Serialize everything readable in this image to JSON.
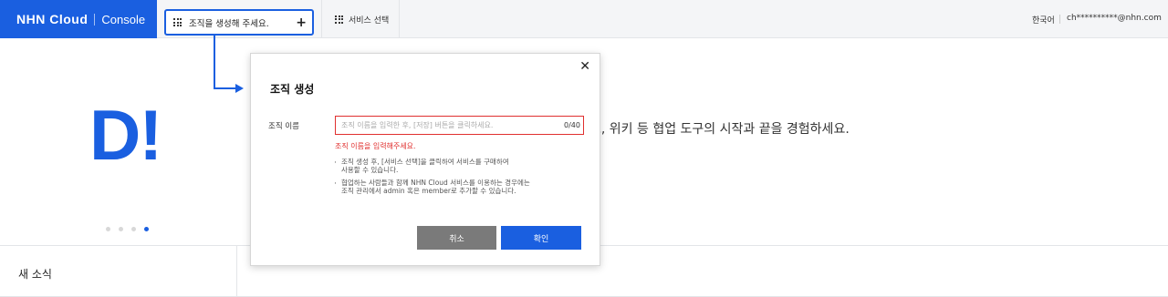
{
  "header": {
    "brand_logo": "NHN Cloud",
    "brand_sub": "Console",
    "org_selector_label": "조직을 생성해 주세요.",
    "org_add_symbol": "+",
    "service_selector_label": "서비스 선택",
    "language": "한국어",
    "user_email": "ch**********@nhn.com",
    "accent_color": "#1a5fe0"
  },
  "hero": {
    "logo_text": "D!",
    "tagline_visible": "브, 위키 등 협업 도구의 시작과 끝을 경험하세요.",
    "carousel_dots": 4,
    "carousel_active_index": 3
  },
  "news": {
    "title": "새 소식"
  },
  "modal": {
    "title": "조직 생성",
    "close_symbol": "✕",
    "field_label": "조직 이름",
    "field_value": "",
    "field_placeholder": "조직 이름을 입력한 후, [저장] 버튼을 클릭하세요.",
    "field_counter": "0/40",
    "error_message": "조직 이름을 입력해주세요.",
    "note_1_line_1": "조직 생성 후, [서비스 선택]을 클릭하여 서비스를 구매하여",
    "note_1_line_2": "사용할 수 있습니다.",
    "note_2_line_1": "협업하는 사람들과 함께 NHN Cloud 서비스를 이용하는 경우에는",
    "note_2_line_2": "조직 관리에서 admin 혹은 member로 추가할 수 있습니다.",
    "cancel_label": "취소",
    "confirm_label": "확인",
    "error_color": "#e0302f"
  }
}
